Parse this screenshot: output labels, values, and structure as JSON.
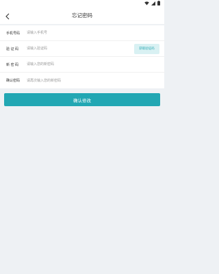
{
  "header": {
    "title": "忘记密码",
    "back_icon": "chevron-left-icon"
  },
  "status_bar": {
    "icons": [
      "wifi-icon",
      "signal-icon",
      "battery-icon"
    ]
  },
  "form": {
    "phone": {
      "label": "手机号码",
      "placeholder": "请输入手机号"
    },
    "code": {
      "label": "验 证 码",
      "placeholder": "请输入验证码",
      "button_label": "获取验证码"
    },
    "new_password": {
      "label": "新 密 码",
      "placeholder": "请输入您的新密码"
    },
    "confirm_password": {
      "label": "确认密码",
      "placeholder": "请再次输入您的新密码"
    }
  },
  "actions": {
    "confirm_label": "确认修改"
  },
  "colors": {
    "accent": "#22a7b3",
    "accent_light": "#d9f1f3",
    "background": "#eef1f4"
  }
}
